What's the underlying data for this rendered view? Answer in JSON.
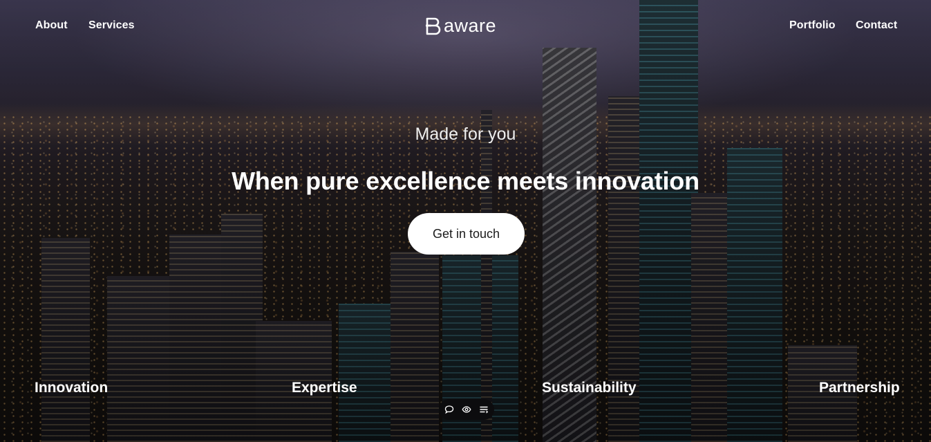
{
  "nav": {
    "left": [
      "About",
      "Services"
    ],
    "right": [
      "Portfolio",
      "Contact"
    ]
  },
  "logo": {
    "text": "aware",
    "mark_icon": "b-monogram-icon"
  },
  "hero": {
    "tagline": "Made for you",
    "headline": "When pure excellence meets innovation",
    "cta_label": "Get in touch"
  },
  "features": [
    "Innovation",
    "Expertise",
    "Sustainability",
    "Partnership"
  ],
  "toolbar": {
    "icons": [
      "comment-icon",
      "eye-icon",
      "list-icon"
    ]
  },
  "colors": {
    "text": "#ffffff",
    "cta_background": "#ffffff",
    "cta_text": "#1a1a1a",
    "toolbar_background": "#0c0c0e"
  }
}
